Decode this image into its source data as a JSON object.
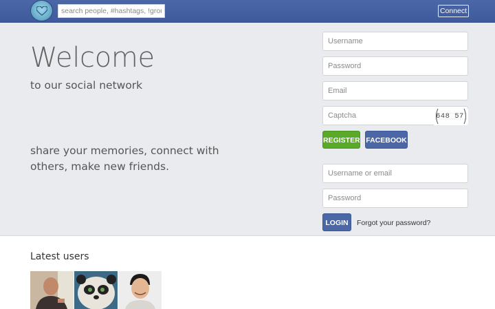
{
  "header": {
    "logo_icon": "heart-logo-icon",
    "search": {
      "placeholder": "search people, #hashtags, !groups"
    },
    "connect_label": "Connect"
  },
  "hero": {
    "title": "Welcome",
    "subtitle": "to our social network",
    "tagline": "share your memories, connect with others, make new friends."
  },
  "register_form": {
    "username_placeholder": "Username",
    "password_placeholder": "Password",
    "email_placeholder": "Email",
    "captcha_placeholder": "Captcha",
    "captcha_code": "648 57",
    "register_label": "REGISTER",
    "facebook_label": "FACEBOOK"
  },
  "login_form": {
    "user_placeholder": "Username or email",
    "password_placeholder": "Password",
    "login_label": "LOGIN",
    "forgot_label": "Forgot your password?"
  },
  "latest": {
    "title": "Latest users"
  },
  "colors": {
    "topbar": "#4361a3",
    "hero_bg": "#e9ebee",
    "register_green": "#5aaa2a",
    "brand_blue": "#4b67a6"
  }
}
